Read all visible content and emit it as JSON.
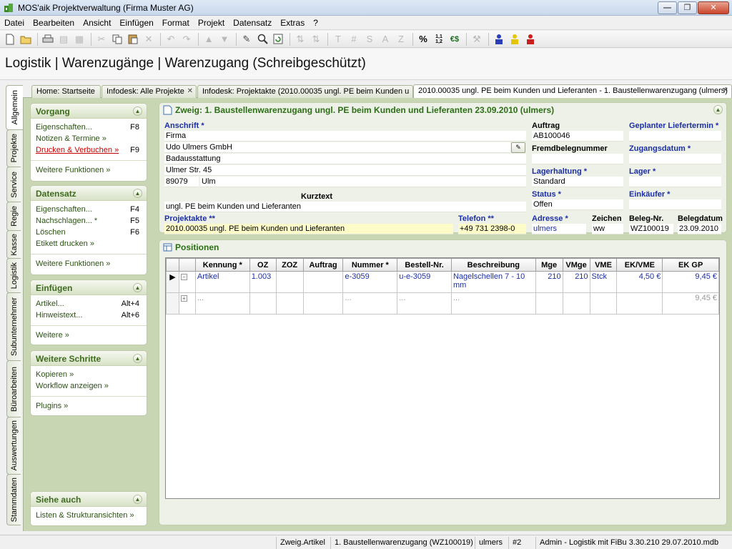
{
  "window": {
    "title": "MOS'aik Projektverwaltung (Firma Muster AG)"
  },
  "menu": [
    "Datei",
    "Bearbeiten",
    "Ansicht",
    "Einfügen",
    "Format",
    "Projekt",
    "Datensatz",
    "Extras",
    "?"
  ],
  "toolbar": {
    "icons": [
      "new-document-icon",
      "open-folder-icon",
      "print-icon",
      "print-preview-icon",
      "copy-doc-icon",
      "cut-icon",
      "copy-icon",
      "paste-icon",
      "delete-icon",
      "undo-icon",
      "redo-icon",
      "move-up-icon",
      "move-down-icon",
      "pencil-icon",
      "search-icon",
      "refresh-icon",
      "sort-asc-icon",
      "sort-desc-icon",
      "text-icon",
      "hash-icon",
      "s-icon",
      "a-icon",
      "z-icon",
      "percent-icon",
      "decimals-icon",
      "currency-icon",
      "tools-icon",
      "user-blue-icon",
      "user-yellow-icon",
      "user-red-icon"
    ],
    "labels": {
      "t": "T",
      "hash": "#",
      "s": "S",
      "a": "A",
      "z": "Z",
      "percent": "%",
      "decimals": "1,1 1,2",
      "euro": "€$"
    }
  },
  "page": {
    "title": "Logistik | Warenzugänge | Warenzugang (Schreibgeschützt)"
  },
  "side_tabs": [
    "Allgemein",
    "Projekte",
    "Service",
    "Regie",
    "Kasse",
    "Logistik",
    "Subunternehmer",
    "Büroarbeiten",
    "Auswertungen",
    "Stammdaten"
  ],
  "doc_tabs": [
    {
      "label": "Home: Startseite"
    },
    {
      "label": "Infodesk: Alle Projekte"
    },
    {
      "label": "Infodesk: Projektakte (2010.00035 ungl. PE beim Kunden u"
    },
    {
      "label": "2010.00035 ungl. PE beim Kunden und Lieferanten - 1. Baustellenwarenzugang (ulmers)"
    }
  ],
  "panels": {
    "vorgang": {
      "title": "Vorgang",
      "items": [
        {
          "label": "Eigenschaften...",
          "key": "F8"
        },
        {
          "label": "Notizen & Termine »",
          "key": ""
        },
        {
          "label": "Drucken & Verbuchen »",
          "key": "F9"
        }
      ],
      "more": "Weitere Funktionen »"
    },
    "datensatz": {
      "title": "Datensatz",
      "items": [
        {
          "label": "Eigenschaften...",
          "key": "F4"
        },
        {
          "label": "Nachschlagen... *",
          "key": "F5"
        },
        {
          "label": "Löschen",
          "key": "F6"
        },
        {
          "label": "Etikett drucken »",
          "key": ""
        }
      ],
      "more": "Weitere Funktionen »"
    },
    "einfuegen": {
      "title": "Einfügen",
      "items": [
        {
          "label": "Artikel...",
          "key": "Alt+4"
        },
        {
          "label": "Hinweistext...",
          "key": "Alt+6"
        }
      ],
      "more": "Weitere »"
    },
    "weitere": {
      "title": "Weitere Schritte",
      "items": [
        {
          "label": "Kopieren »"
        },
        {
          "label": "Workflow anzeigen »"
        }
      ],
      "more": "Plugins »"
    },
    "siehe": {
      "title": "Siehe auch",
      "items": [
        {
          "label": "Listen & Strukturansichten »"
        }
      ]
    }
  },
  "zweig": {
    "title": "Zweig: 1. Baustellenwarenzugang ungl. PE beim Kunden und Lieferanten 23.09.2010 (ulmers)",
    "anschrift_label": "Anschrift *",
    "address_lines": [
      "Firma",
      "Udo Ulmers GmbH",
      "Badausstattung",
      "Ulmer Str. 45"
    ],
    "plz": "89079",
    "ort": "Ulm",
    "kurztext_label": "Kurztext",
    "kurztext": "ungl. PE beim Kunden und Lieferanten",
    "projektakte_label": "Projektakte **",
    "projektakte": "2010.00035 ungl. PE beim Kunden und Lieferanten",
    "telefon_label": "Telefon **",
    "telefon": "+49 731 2398-0",
    "auftrag_label": "Auftrag",
    "auftrag": "AB100046",
    "fremdbeleg_label": "Fremdbelegnummer",
    "fremdbeleg": "",
    "lagerhaltung_label": "Lagerhaltung *",
    "lagerhaltung": "Standard",
    "status_label": "Status *",
    "status": "Offen",
    "adresse_label": "Adresse *",
    "adresse": "ulmers",
    "zeichen_label": "Zeichen",
    "zeichen": "ww",
    "liefertermin_label": "Geplanter Liefertermin *",
    "liefertermin": "",
    "zugangsdatum_label": "Zugangsdatum *",
    "zugangsdatum": "",
    "lager_label": "Lager *",
    "lager": "",
    "einkaeufer_label": "Einkäufer *",
    "einkaeufer": "",
    "belegnr_label": "Beleg-Nr.",
    "belegnr": "WZ100019",
    "belegdatum_label": "Belegdatum",
    "belegdatum": "23.09.2010"
  },
  "positionen": {
    "title": "Positionen",
    "columns": [
      "Kennung *",
      "OZ",
      "ZOZ",
      "Auftrag",
      "Nummer *",
      "Bestell-Nr.",
      "Beschreibung",
      "Mge",
      "VMge",
      "VME",
      "EK/VME",
      "EK GP"
    ],
    "rows": [
      {
        "kennung": "Artikel",
        "oz": "1.003",
        "zoz": "",
        "auftrag": "",
        "nummer": "e-3059",
        "bestell": "u-e-3059",
        "beschreibung": "Nagelschellen 7 - 10 mm",
        "mge": "210",
        "vmge": "210",
        "vme": "Stck",
        "ek_vme": "4,50 €",
        "ek_gp": "9,45 €"
      },
      {
        "kennung": "...",
        "oz": "",
        "zoz": "",
        "auftrag": "",
        "nummer": "...",
        "bestell": "...",
        "beschreibung": "...",
        "mge": "",
        "vmge": "",
        "vme": "",
        "ek_vme": "",
        "ek_gp": "9,45 €"
      }
    ]
  },
  "statusbar": [
    "Zweig.Artikel",
    "1. Baustellenwarenzugang (WZ100019)",
    "ulmers",
    "#2",
    "Admin - Logistik mit FiBu 3.30.210 29.07.2010.mdb"
  ]
}
